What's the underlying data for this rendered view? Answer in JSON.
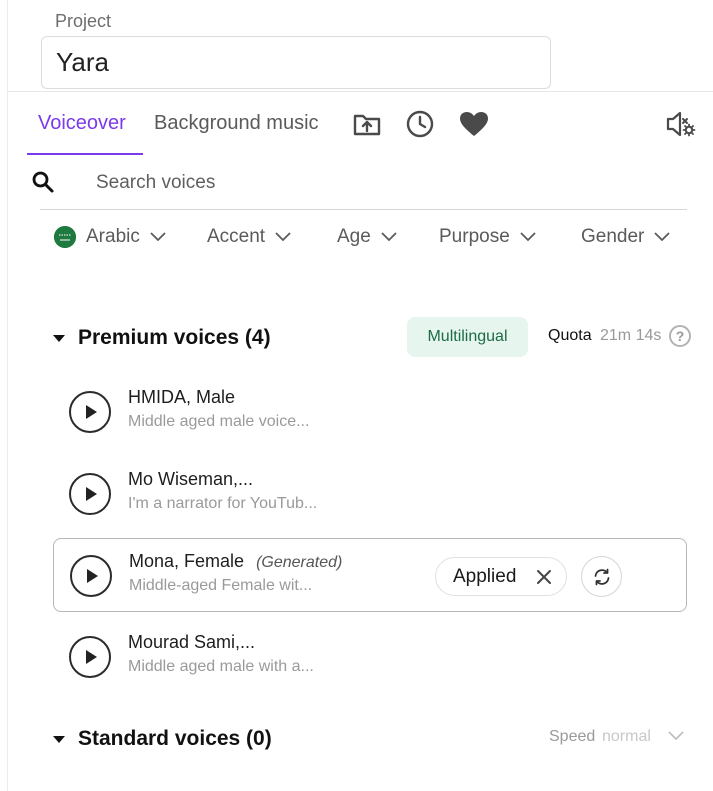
{
  "project": {
    "label": "Project",
    "value": "Yara"
  },
  "tabs": [
    {
      "label": "Voiceover",
      "active": true
    },
    {
      "label": "Background music",
      "active": false
    }
  ],
  "tab_icons": [
    "upload-folder-icon",
    "history-clock-icon",
    "favorites-heart-icon",
    "voice-settings-icon"
  ],
  "search": {
    "placeholder": "Search voices"
  },
  "filters": [
    {
      "label": "Arabic",
      "icon": "saudi-flag-icon"
    },
    {
      "label": "Accent"
    },
    {
      "label": "Age"
    },
    {
      "label": "Purpose"
    },
    {
      "label": "Gender"
    }
  ],
  "premium": {
    "title": "Premium voices (4)",
    "badge": "Multilingual",
    "quota_label": "Quota",
    "quota_value": "21m 14s"
  },
  "voices": [
    {
      "name": "HMIDA, Male",
      "tag": "",
      "desc": "Middle aged male voice..."
    },
    {
      "name": "Mo Wiseman,...",
      "tag": "",
      "desc": "I'm a narrator for YouTub..."
    },
    {
      "name": "Mona, Female",
      "tag": "(Generated)",
      "desc": "Middle-aged Female wit...",
      "applied_label": "Applied",
      "selected": true
    },
    {
      "name": "Mourad Sami,...",
      "tag": "",
      "desc": "Middle aged male with a..."
    }
  ],
  "standard": {
    "title": "Standard voices (0)",
    "speed_label": "Speed",
    "speed_value": "normal"
  },
  "colors": {
    "accent": "#7c3aed",
    "badge_bg": "#e6f6ee",
    "badge_text": "#1d6b46"
  }
}
